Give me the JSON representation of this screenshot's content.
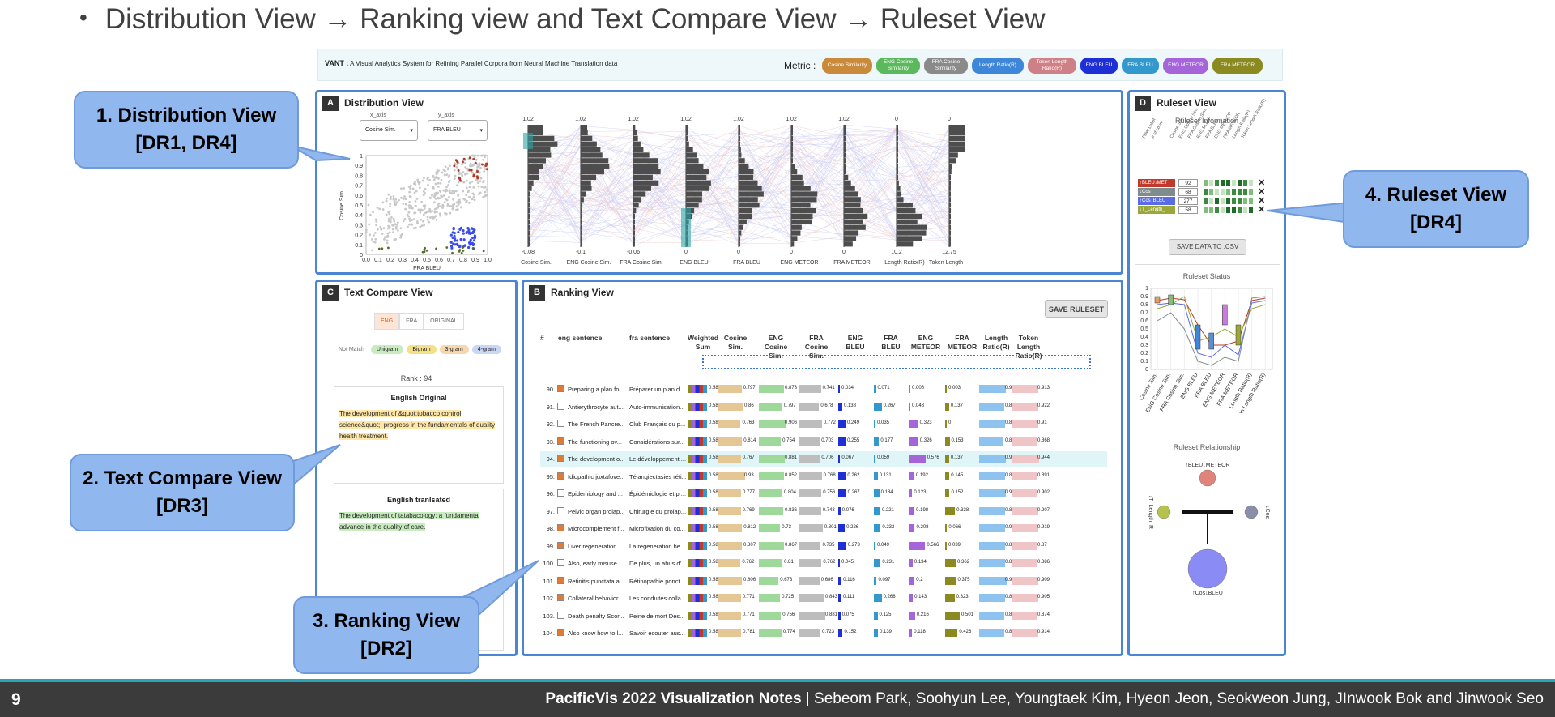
{
  "heading": "Distribution View → Ranking view and Text Compare View → Ruleset View",
  "app": {
    "title_bold": "VANT :",
    "title_rest": "A Visual Analytics System for Refining Parallel Corpora from Neural Machine Translation data",
    "metric_label": "Metric :",
    "metrics": [
      {
        "label": "Cosine Similarity",
        "color": "#c98b3b"
      },
      {
        "label": "ENG Cosine Similarity",
        "color": "#5cb85c"
      },
      {
        "label": "FRA Cosine Similarity",
        "color": "#8a8a8a"
      },
      {
        "label": "Length Ratio(R)",
        "color": "#3d86d8"
      },
      {
        "label": "Token Length Ratio(R)",
        "color": "#cf7f86"
      },
      {
        "label": "ENG BLEU",
        "color": "#1f2fd6"
      },
      {
        "label": "FRA BLEU",
        "color": "#3399cc"
      },
      {
        "label": "ENG METEOR",
        "color": "#a565d8"
      },
      {
        "label": "FRA METEOR",
        "color": "#8a8a20"
      }
    ]
  },
  "distribution": {
    "tag": "A",
    "title": "Distribution View",
    "x_axis_label": "x_axis",
    "x_axis_value": "Cosine Sim.",
    "y_axis_label": "y_axis",
    "y_axis_value": "FRA BLEU",
    "scatter_ylabel": "Cosine Sim.",
    "scatter_xlabel": "FRA BLEU",
    "scatter_yticks": [
      "1",
      "0.9",
      "0.8",
      "0.7",
      "0.6",
      "0.5",
      "0.4",
      "0.3",
      "0.2",
      "0.1",
      "0"
    ],
    "scatter_xticks": [
      "0.0",
      "0.1",
      "0.2",
      "0.3",
      "0.4",
      "0.5",
      "0.6",
      "0.7",
      "0.8",
      "0.9",
      "1.0"
    ],
    "axes": [
      {
        "name": "Cosine Sim.",
        "top": "1.02",
        "bottom": "-0.08"
      },
      {
        "name": "ENG Cosine Sim.",
        "top": "1.02",
        "bottom": "-0.1"
      },
      {
        "name": "FRA Cosine Sim.",
        "top": "1.02",
        "bottom": "-0.06"
      },
      {
        "name": "ENG BLEU",
        "top": "1.02",
        "bottom": "0"
      },
      {
        "name": "FRA BLEU",
        "top": "1.02",
        "bottom": "0"
      },
      {
        "name": "ENG METEOR",
        "top": "1.02",
        "bottom": "0"
      },
      {
        "name": "FRA METEOR",
        "top": "1.02",
        "bottom": "0"
      },
      {
        "name": "Length Ratio(R)",
        "top": "0",
        "bottom": "10.2"
      },
      {
        "name": "Token Length Ratio(R)",
        "top": "0",
        "bottom": "12.75"
      }
    ]
  },
  "textcompare": {
    "tag": "C",
    "title": "Text Compare View",
    "tabs": [
      "ENG",
      "FRA",
      "ORIGINAL"
    ],
    "legend_label": "Not Match",
    "legend": [
      {
        "label": "Unigram",
        "color": "#c8ebbf"
      },
      {
        "label": "Bigram",
        "color": "#f4e08a"
      },
      {
        "label": "3-gram",
        "color": "#f6d7b0"
      },
      {
        "label": "4-gram",
        "color": "#c9d7f5"
      }
    ],
    "rank": "Rank : 94",
    "orig_title": "English Original",
    "orig_text": "The development of &quot;tobacco control science&quot;: progress in the fundamentals of quality health treatment.",
    "trans_title": "English tranlsated",
    "trans_text": "The development of tatabacology: a fundamental advance in the quality of care."
  },
  "ranking": {
    "tag": "B",
    "title": "Ranking View",
    "save_button": "SAVE RULESET",
    "columns": [
      "#",
      "eng sentence",
      "fra sentence",
      "Weighted Sum",
      "Cosine Sim.",
      "ENG Cosine Sim.",
      "FRA Cosine Sim.",
      "ENG BLEU",
      "FRA BLEU",
      "ENG METEOR",
      "FRA METEOR",
      "Length Ratio(R)",
      "Token Length Ratio(R)"
    ],
    "rows": [
      {
        "n": "90.",
        "checked": true,
        "eng": "Preparing a plan fo...",
        "fra": "Préparer un plan d...",
        "ws": "0.58",
        "cs": "0.797",
        "ecs": "0.873",
        "fcs": "0.741",
        "eb": "0.034",
        "fb": "0.071",
        "em": "0.008",
        "fm": "0.003",
        "lr": "0.903",
        "tl": "0.913"
      },
      {
        "n": "91.",
        "checked": false,
        "eng": "Antierythrocyte aut...",
        "fra": "Auto-immunisation...",
        "ws": "0.581",
        "cs": "0.86",
        "ecs": "0.797",
        "fcs": "0.678",
        "eb": "0.138",
        "fb": "0.267",
        "em": "0.048",
        "fm": "0.137",
        "lr": "0.854",
        "tl": "0.922"
      },
      {
        "n": "92.",
        "checked": false,
        "eng": "The French Pancre...",
        "fra": "Club Français du p...",
        "ws": "0.582",
        "cs": "0.763",
        "ecs": "0.906",
        "fcs": "0.772",
        "eb": "0.249",
        "fb": "0.035",
        "em": "0.323",
        "fm": "0",
        "lr": "0.889",
        "tl": "0.91"
      },
      {
        "n": "93.",
        "checked": true,
        "eng": "The functioning ov...",
        "fra": "Considérations sur...",
        "ws": "0.582",
        "cs": "0.814",
        "ecs": "0.754",
        "fcs": "0.703",
        "eb": "0.255",
        "fb": "0.177",
        "em": "0.326",
        "fm": "0.153",
        "lr": "0.842",
        "tl": "0.868"
      },
      {
        "n": "94.",
        "checked": true,
        "eng": "The development o...",
        "fra": "Le développement ...",
        "ws": "0.582",
        "cs": "0.767",
        "ecs": "0.881",
        "fcs": "0.706",
        "eb": "0.067",
        "fb": "0.059",
        "em": "0.576",
        "fm": "0.137",
        "lr": "0.907",
        "tl": "0.944",
        "selected": true
      },
      {
        "n": "95.",
        "checked": true,
        "eng": "Idiopathic juxtafove...",
        "fra": "Télangiectasies réti...",
        "ws": "0.583",
        "cs": "0.93",
        "ecs": "0.852",
        "fcs": "0.768",
        "eb": "0.262",
        "fb": "0.131",
        "em": "0.192",
        "fm": "0.145",
        "lr": "0.895",
        "tl": "0.891"
      },
      {
        "n": "96.",
        "checked": false,
        "eng": "Epidemiology and ...",
        "fra": "Épidémiologie et pr...",
        "ws": "0.583",
        "cs": "0.777",
        "ecs": "0.804",
        "fcs": "0.756",
        "eb": "0.267",
        "fb": "0.184",
        "em": "0.123",
        "fm": "0.152",
        "lr": "0.903",
        "tl": "0.902"
      },
      {
        "n": "97.",
        "checked": false,
        "eng": "Pelvic organ prolap...",
        "fra": "Chirurgie du prolap...",
        "ws": "0.584",
        "cs": "0.769",
        "ecs": "0.836",
        "fcs": "0.743",
        "eb": "0.076",
        "fb": "0.221",
        "em": "0.198",
        "fm": "0.338",
        "lr": "0.894",
        "tl": "0.907"
      },
      {
        "n": "98.",
        "checked": true,
        "eng": "Microcomplement f...",
        "fra": "Microfixation du co...",
        "ws": "0.584",
        "cs": "0.812",
        "ecs": "0.73",
        "fcs": "0.801",
        "eb": "0.226",
        "fb": "0.232",
        "em": "0.208",
        "fm": "0.066",
        "lr": "0.90",
        "tl": "0.919"
      },
      {
        "n": "99.",
        "checked": true,
        "eng": "Liver regeneration ...",
        "fra": "La regeneration he...",
        "ws": "0.584",
        "cs": "0.807",
        "ecs": "0.867",
        "fcs": "0.735",
        "eb": "0.273",
        "fb": "0.049",
        "em": "0.566",
        "fm": "0.039",
        "lr": "0.89",
        "tl": "0.87"
      },
      {
        "n": "100.",
        "checked": false,
        "eng": "Also, early misuse ...",
        "fra": "De plus, un abus d'...",
        "ws": "0.584",
        "cs": "0.762",
        "ecs": "0.81",
        "fcs": "0.762",
        "eb": "0.045",
        "fb": "0.231",
        "em": "0.134",
        "fm": "0.362",
        "lr": "0.877",
        "tl": "0.886"
      },
      {
        "n": "101.",
        "checked": true,
        "eng": "Retinitis punctata a...",
        "fra": "Rétinopathie ponct...",
        "ws": "0.585",
        "cs": "0.806",
        "ecs": "0.673",
        "fcs": "0.686",
        "eb": "0.116",
        "fb": "0.097",
        "em": "0.2",
        "fm": "0.375",
        "lr": "0.94",
        "tl": "0.909"
      },
      {
        "n": "102.",
        "checked": true,
        "eng": "Collateral behavior...",
        "fra": "Les conduites colla...",
        "ws": "0.585",
        "cs": "0.771",
        "ecs": "0.725",
        "fcs": "0.843",
        "eb": "0.111",
        "fb": "0.266",
        "em": "0.143",
        "fm": "0.323",
        "lr": "0.883",
        "tl": "0.905"
      },
      {
        "n": "103.",
        "checked": false,
        "eng": "Death penalty Scor...",
        "fra": "Peine de mort Des...",
        "ws": "0.585",
        "cs": "0.771",
        "ecs": "0.756",
        "fcs": "0.881",
        "eb": "0.075",
        "fb": "0.125",
        "em": "0.216",
        "fm": "0.501",
        "lr": "0.872",
        "tl": "0.874"
      },
      {
        "n": "104.",
        "checked": true,
        "eng": "Also know how to l...",
        "fra": "Savoir ecouter aus...",
        "ws": "0.585",
        "cs": "0.781",
        "ecs": "0.774",
        "fcs": "0.723",
        "eb": "0.152",
        "fb": "0.139",
        "em": "0.118",
        "fm": "0.426",
        "lr": "0.855",
        "tl": "0.914"
      }
    ]
  },
  "ruleset": {
    "tag": "D",
    "title": "Ruleset View",
    "info_title": "Ruleset Information",
    "info_cols": [
      "Filter Label",
      "# of count",
      "Cosine Sim.",
      "ENG Cosine Sim.",
      "FRA Cosine Sim.",
      "ENG BLEU",
      "FRA BLEU",
      "ENG METEOR",
      "FRA METEOR",
      "Length Ratio(R)",
      "Token Length Ratio(R)"
    ],
    "rules": [
      {
        "label": "↑BLEU↓MET",
        "count": "92",
        "color": "#c0392b"
      },
      {
        "label": "↓Cos",
        "count": "68",
        "color": "#7f8c8d"
      },
      {
        "label": "↑Cos↓BLEU",
        "count": "277",
        "color": "#5a6be8"
      },
      {
        "label": "↓T_Length_",
        "count": "58",
        "color": "#9aa83b"
      }
    ],
    "save_csv": "SAVE DATA TO .CSV",
    "status_title": "Ruleset Status",
    "status_yticks": [
      "1",
      "0.9",
      "0.8",
      "0.7",
      "0.6",
      "0.5",
      "0.4",
      "0.3",
      "0.2",
      "0.1",
      "0"
    ],
    "status_xticks": [
      "Cosine Sim.",
      "ENG Cosine Sim.",
      "FRA Cosine Sim.",
      "ENG BLEU",
      "FRA BLEU",
      "ENG METEOR",
      "FRA METEOR",
      "Length Ratio(R)",
      "Token Length Ratio(R)"
    ],
    "relationship_title": "Ruleset Relationship",
    "rel_nodes": [
      {
        "label": "↑BLEU↓METEOR",
        "color": "#e0837a"
      },
      {
        "label": "↓T_Length_R",
        "color": "#b6c24c"
      },
      {
        "label": "↓Cos",
        "color": "#8a8ea8"
      },
      {
        "label": "↑Cos↓BLEU",
        "color": "#8a8bf4"
      }
    ]
  },
  "callouts": {
    "c1": "1. Distribution View [DR1, DR4]",
    "c2": "2. Text Compare View [DR3]",
    "c3": "3. Ranking View [DR2]",
    "c4": "4. Ruleset View [DR4]"
  },
  "footer": {
    "page": "9",
    "venue": "PacificVis 2022 Visualization Notes",
    "authors": " | Sebeom Park, Soohyun Lee, Youngtaek Kim, Hyeon Jeon, Seokweon Jung, JInwook Bok and Jinwook Seo"
  }
}
